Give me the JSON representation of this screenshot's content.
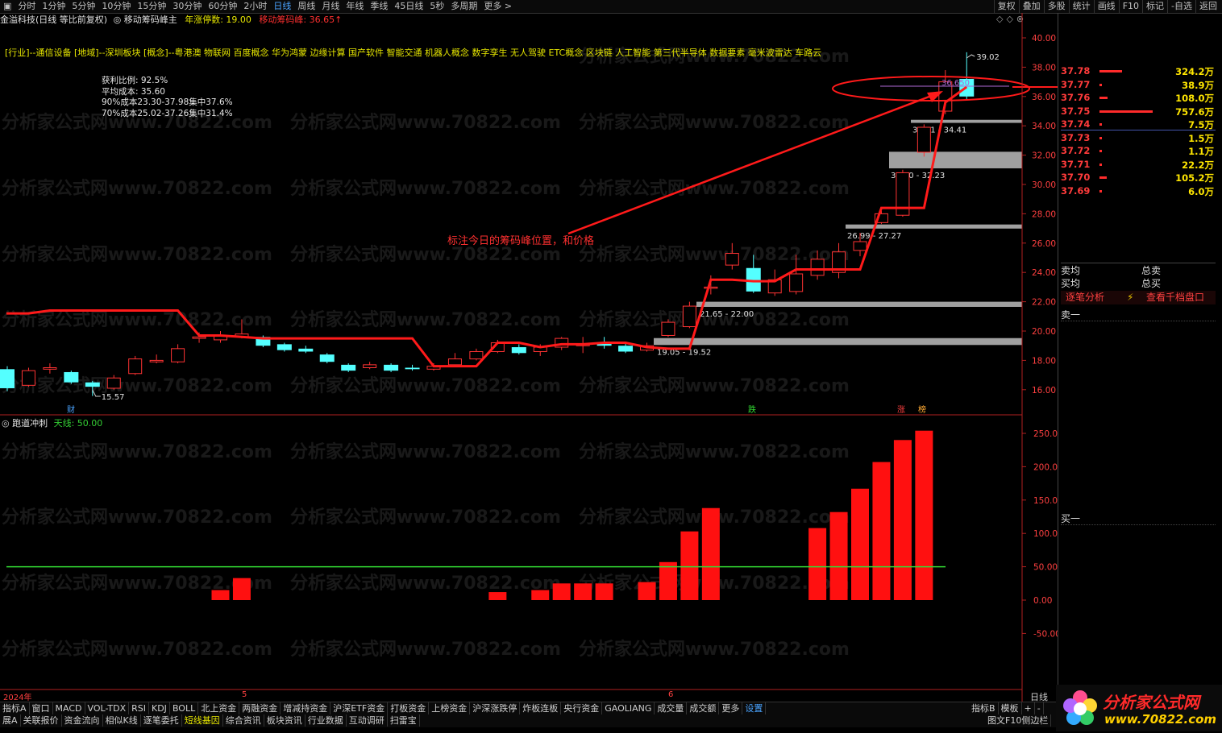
{
  "toolbar": {
    "periods": [
      "分时",
      "1分钟",
      "5分钟",
      "10分钟",
      "15分钟",
      "30分钟",
      "60分钟",
      "2小时",
      "日线",
      "周线",
      "月线",
      "年线",
      "季线",
      "45日线",
      "5秒",
      "多周期",
      "更多 >"
    ],
    "active_period": "日线",
    "right_buttons": [
      "复权",
      "叠加",
      "多股",
      "统计",
      "画线",
      "F10",
      "标记",
      "-自选",
      "返回"
    ]
  },
  "title": {
    "stock": "金溢科技(日线 等比前复权)",
    "indicator": "◎ 移动筹码峰主",
    "limit_label": "年涨停数: 19.00",
    "peak_label": "移动筹码峰: 36.65↑"
  },
  "concepts": "[行业]--通信设备 [地域]--深圳板块 [概念]--粤港澳 物联网 百度概念 华为鸿蒙 边缘计算 国产软件 智能交通 机器人概念 数字孪生 无人驾驶 ETC概念 区块链 人工智能 第三代半导体 数据要素 毫米波雷达 车路云",
  "chip_stats": [
    "获利比例: 92.5%",
    "平均成本: 35.60",
    "90%成本23.30-37.98集中37.6%",
    "70%成本25.02-37.26集中31.4%"
  ],
  "annotation": "标注今日的筹码峰位置，和价格",
  "zones": [
    "34.21 - 34.41",
    "31.10 - 32.23",
    "26.99 - 27.27",
    "21.65 - 22.00",
    "19.05 - 19.52"
  ],
  "price_marks": {
    "high": "39.02",
    "low": "15.57",
    "peak": "36.650"
  },
  "event_marks": {
    "cai": "财",
    "die": "跌",
    "zhang": "涨",
    "bang": "榜"
  },
  "price_axis": [
    "40.00",
    "38.00",
    "36.00",
    "34.00",
    "32.00",
    "30.00",
    "28.00",
    "26.00",
    "24.00",
    "22.00",
    "20.00",
    "18.00",
    "16.00"
  ],
  "sub_indicator": {
    "name": "跑道冲刺",
    "line_label": "天线: 50.00"
  },
  "sub_axis": [
    "250.0",
    "200.0",
    "150.0",
    "100.0",
    "50.00",
    "0.00",
    "-50.00"
  ],
  "date_axis": {
    "year": "2024年",
    "m5": "5",
    "m6": "6",
    "period": "日线"
  },
  "order_book": [
    {
      "price": "37.78",
      "vol": "324.2万",
      "bar": 0.35
    },
    {
      "price": "37.77",
      "vol": "38.9万",
      "bar": 0.04
    },
    {
      "price": "37.76",
      "vol": "108.0万",
      "bar": 0.12
    },
    {
      "price": "37.75",
      "vol": "757.6万",
      "bar": 0.82
    },
    {
      "price": "37.74",
      "vol": "7.5万",
      "bar": 0.01
    },
    {
      "price": "37.73",
      "vol": "1.5万",
      "bar": 0.01
    },
    {
      "price": "37.72",
      "vol": "1.1万",
      "bar": 0.01
    },
    {
      "price": "37.71",
      "vol": "22.2万",
      "bar": 0.02
    },
    {
      "price": "37.70",
      "vol": "105.2万",
      "bar": 0.11
    },
    {
      "price": "37.69",
      "vol": "6.0万",
      "bar": 0.01
    }
  ],
  "panel": {
    "sell_avg": "卖均",
    "buy_avg": "买均",
    "total_sell": "总卖",
    "total_buy": "总买",
    "tick_analysis": "逐笔分析",
    "thousand_depth": "查看千档盘口",
    "sell1": "卖一",
    "buy1": "买一"
  },
  "bottom_tabs": [
    "指标A",
    "窗口",
    "MACD",
    "VOL-TDX",
    "RSI",
    "KDJ",
    "BOLL",
    "北上资金",
    "两融资金",
    "增减持资金",
    "沪深ETF资金",
    "打板资金",
    "上榜资金",
    "沪深涨跌停",
    "炸板连板",
    "央行资金",
    "GAOLIANG",
    "成交量",
    "成交额",
    "更多",
    "设置"
  ],
  "bottom_tabs_right": [
    "指标B",
    "模板",
    "+",
    "-"
  ],
  "bottom_links": [
    "展A",
    "关联报价",
    "资金流向",
    "相似K线",
    "逐笔委托",
    "短线基因",
    "综合资讯",
    "板块资讯",
    "行业数据",
    "互动调研",
    "扫雷宝"
  ],
  "bottom_right_link": "图文F10侧边栏",
  "watermark": "分析家公式网www.70822.com",
  "logo": {
    "name": "分析家公式网",
    "url": "www.70822.com"
  },
  "chart_data": {
    "type": "candlestick",
    "candles": [
      {
        "o": 17.4,
        "c": 16.1,
        "h": 17.6,
        "l": 15.9
      },
      {
        "o": 16.3,
        "c": 17.3,
        "h": 17.5,
        "l": 16.2
      },
      {
        "o": 17.4,
        "c": 17.5,
        "h": 17.8,
        "l": 17.1
      },
      {
        "o": 17.2,
        "c": 16.5,
        "h": 17.3,
        "l": 16.4
      },
      {
        "o": 16.5,
        "c": 16.2,
        "h": 16.6,
        "l": 15.57
      },
      {
        "o": 16.1,
        "c": 16.8,
        "h": 17.0,
        "l": 16.0
      },
      {
        "o": 17.1,
        "c": 18.1,
        "h": 18.3,
        "l": 17.0
      },
      {
        "o": 17.9,
        "c": 18.0,
        "h": 18.4,
        "l": 17.8
      },
      {
        "o": 17.9,
        "c": 18.8,
        "h": 19.1,
        "l": 17.8
      },
      {
        "o": 19.5,
        "c": 19.6,
        "h": 19.9,
        "l": 19.2
      },
      {
        "o": 19.4,
        "c": 19.7,
        "h": 20.0,
        "l": 19.2
      },
      {
        "o": 19.6,
        "c": 19.8,
        "h": 20.8,
        "l": 19.5
      },
      {
        "o": 19.6,
        "c": 19.0,
        "h": 19.7,
        "l": 18.9
      },
      {
        "o": 19.1,
        "c": 18.7,
        "h": 19.2,
        "l": 18.6
      },
      {
        "o": 18.8,
        "c": 18.6,
        "h": 19.0,
        "l": 18.5
      },
      {
        "o": 18.4,
        "c": 17.9,
        "h": 18.5,
        "l": 17.8
      },
      {
        "o": 17.7,
        "c": 17.3,
        "h": 17.8,
        "l": 17.2
      },
      {
        "o": 17.5,
        "c": 17.7,
        "h": 17.9,
        "l": 17.4
      },
      {
        "o": 17.7,
        "c": 17.3,
        "h": 17.8,
        "l": 17.2
      },
      {
        "o": 17.5,
        "c": 17.4,
        "h": 17.7,
        "l": 17.3
      },
      {
        "o": 17.4,
        "c": 17.6,
        "h": 17.8,
        "l": 17.3
      },
      {
        "o": 17.7,
        "c": 18.1,
        "h": 18.5,
        "l": 17.6
      },
      {
        "o": 18.1,
        "c": 18.6,
        "h": 18.8,
        "l": 18.0
      },
      {
        "o": 18.6,
        "c": 19.2,
        "h": 19.4,
        "l": 18.5
      },
      {
        "o": 18.9,
        "c": 18.5,
        "h": 19.1,
        "l": 18.4
      },
      {
        "o": 18.6,
        "c": 18.9,
        "h": 19.1,
        "l": 18.3
      },
      {
        "o": 18.9,
        "c": 19.5,
        "h": 19.6,
        "l": 18.7
      },
      {
        "o": 19.0,
        "c": 19.1,
        "h": 19.6,
        "l": 18.5
      },
      {
        "o": 19.2,
        "c": 19.0,
        "h": 19.6,
        "l": 18.8
      },
      {
        "o": 19.0,
        "c": 18.6,
        "h": 19.2,
        "l": 18.5
      },
      {
        "o": 18.7,
        "c": 19.0,
        "h": 19.2,
        "l": 18.6
      },
      {
        "o": 19.7,
        "c": 20.6,
        "h": 20.8,
        "l": 19.6
      },
      {
        "o": 20.3,
        "c": 21.7,
        "h": 22.0,
        "l": 20.2
      },
      {
        "o": 23.0,
        "c": 23.0,
        "h": 23.8,
        "l": 22.5
      },
      {
        "o": 24.5,
        "c": 25.3,
        "h": 26.0,
        "l": 24.2
      },
      {
        "o": 24.3,
        "c": 22.7,
        "h": 25.2,
        "l": 22.6
      },
      {
        "o": 22.6,
        "c": 23.5,
        "h": 24.2,
        "l": 22.4
      },
      {
        "o": 22.7,
        "c": 23.9,
        "h": 25.2,
        "l": 22.5
      },
      {
        "o": 23.8,
        "c": 24.9,
        "h": 25.5,
        "l": 23.5
      },
      {
        "o": 24.0,
        "c": 25.4,
        "h": 26.0,
        "l": 23.6
      },
      {
        "o": 25.5,
        "c": 26.1,
        "h": 26.7,
        "l": 25.1
      },
      {
        "o": 27.4,
        "c": 28.0,
        "h": 28.2,
        "l": 27.3
      },
      {
        "o": 27.9,
        "c": 30.8,
        "h": 31.0,
        "l": 27.8
      },
      {
        "o": 32.2,
        "c": 33.9,
        "h": 34.1,
        "l": 31.9
      },
      {
        "o": 35.0,
        "c": 37.0,
        "h": 37.8,
        "l": 34.8
      },
      {
        "o": 37.2,
        "c": 36.0,
        "h": 39.02,
        "l": 35.8
      }
    ],
    "peak_line": [
      21.2,
      21.2,
      21.4,
      21.4,
      21.4,
      21.4,
      21.4,
      21.4,
      21.4,
      19.7,
      19.7,
      19.6,
      19.5,
      19.5,
      19.5,
      19.5,
      19.5,
      19.5,
      19.5,
      19.5,
      17.6,
      17.6,
      17.6,
      19.2,
      19.2,
      18.9,
      19.1,
      19.1,
      19.2,
      19.2,
      18.9,
      18.8,
      18.8,
      23.5,
      23.5,
      23.4,
      23.4,
      24.2,
      24.2,
      24.2,
      24.2,
      28.4,
      28.4,
      28.4,
      35.6,
      36.65
    ],
    "bars": [
      0,
      0,
      0,
      0,
      0,
      0,
      0,
      0,
      0,
      0,
      15,
      33,
      0,
      0,
      0,
      0,
      0,
      0,
      0,
      0,
      0,
      0,
      0,
      12,
      0,
      15,
      25,
      25,
      25,
      0,
      27,
      57,
      103,
      138,
      0,
      0,
      0,
      0,
      108,
      132,
      167,
      207,
      240,
      254
    ],
    "sky_line": 50,
    "ylim": [
      15,
      41
    ],
    "sub_ylim": [
      -100,
      265
    ]
  }
}
